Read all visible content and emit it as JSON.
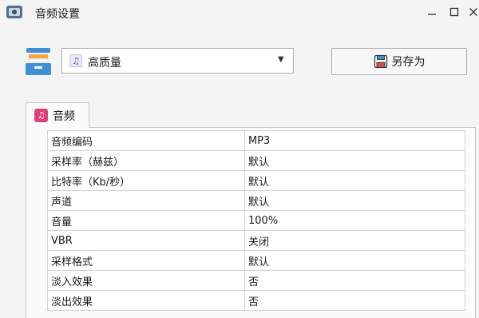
{
  "window": {
    "title": "音频设置"
  },
  "preset": {
    "selected": "高质量"
  },
  "actions": {
    "save_as_label": "另存为"
  },
  "tabs": [
    {
      "label": "音频",
      "icon": "music-note-icon",
      "color": "#e0407a"
    }
  ],
  "properties": [
    {
      "name": "音频编码",
      "value": "MP3"
    },
    {
      "name": "采样率（赫兹）",
      "value": "默认"
    },
    {
      "name": "比特率（Kb/秒）",
      "value": "默认"
    },
    {
      "name": "声道",
      "value": "默认"
    },
    {
      "name": "音量",
      "value": "100%"
    },
    {
      "name": "VBR",
      "value": "关闭"
    },
    {
      "name": "采样格式",
      "value": "默认"
    },
    {
      "name": "淡入效果",
      "value": "否"
    },
    {
      "name": "淡出效果",
      "value": "否"
    }
  ]
}
